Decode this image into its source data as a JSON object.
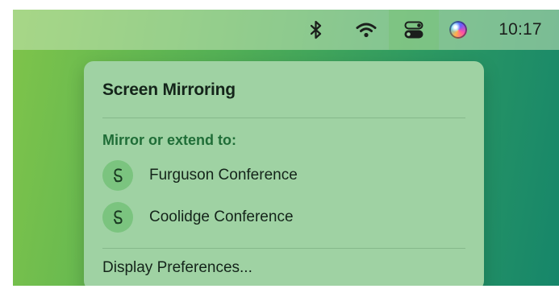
{
  "menubar": {
    "icons": [
      "bluetooth-icon",
      "wifi-icon",
      "control-center-icon",
      "siri-icon"
    ],
    "clock": "10:17"
  },
  "screen_mirroring_menu": {
    "title": "Screen Mirroring",
    "section_label": "Mirror or extend to:",
    "devices": [
      {
        "label": "Furguson Conference",
        "icon": "airplay-icon"
      },
      {
        "label": "Coolidge Conference",
        "icon": "airplay-icon"
      }
    ],
    "display_preferences_label": "Display Preferences..."
  },
  "colors": {
    "panel_background": "#9fd2a3",
    "section_label": "#1f6d37",
    "device_icon_circle": "#7bc47f",
    "text": "#14241a"
  }
}
